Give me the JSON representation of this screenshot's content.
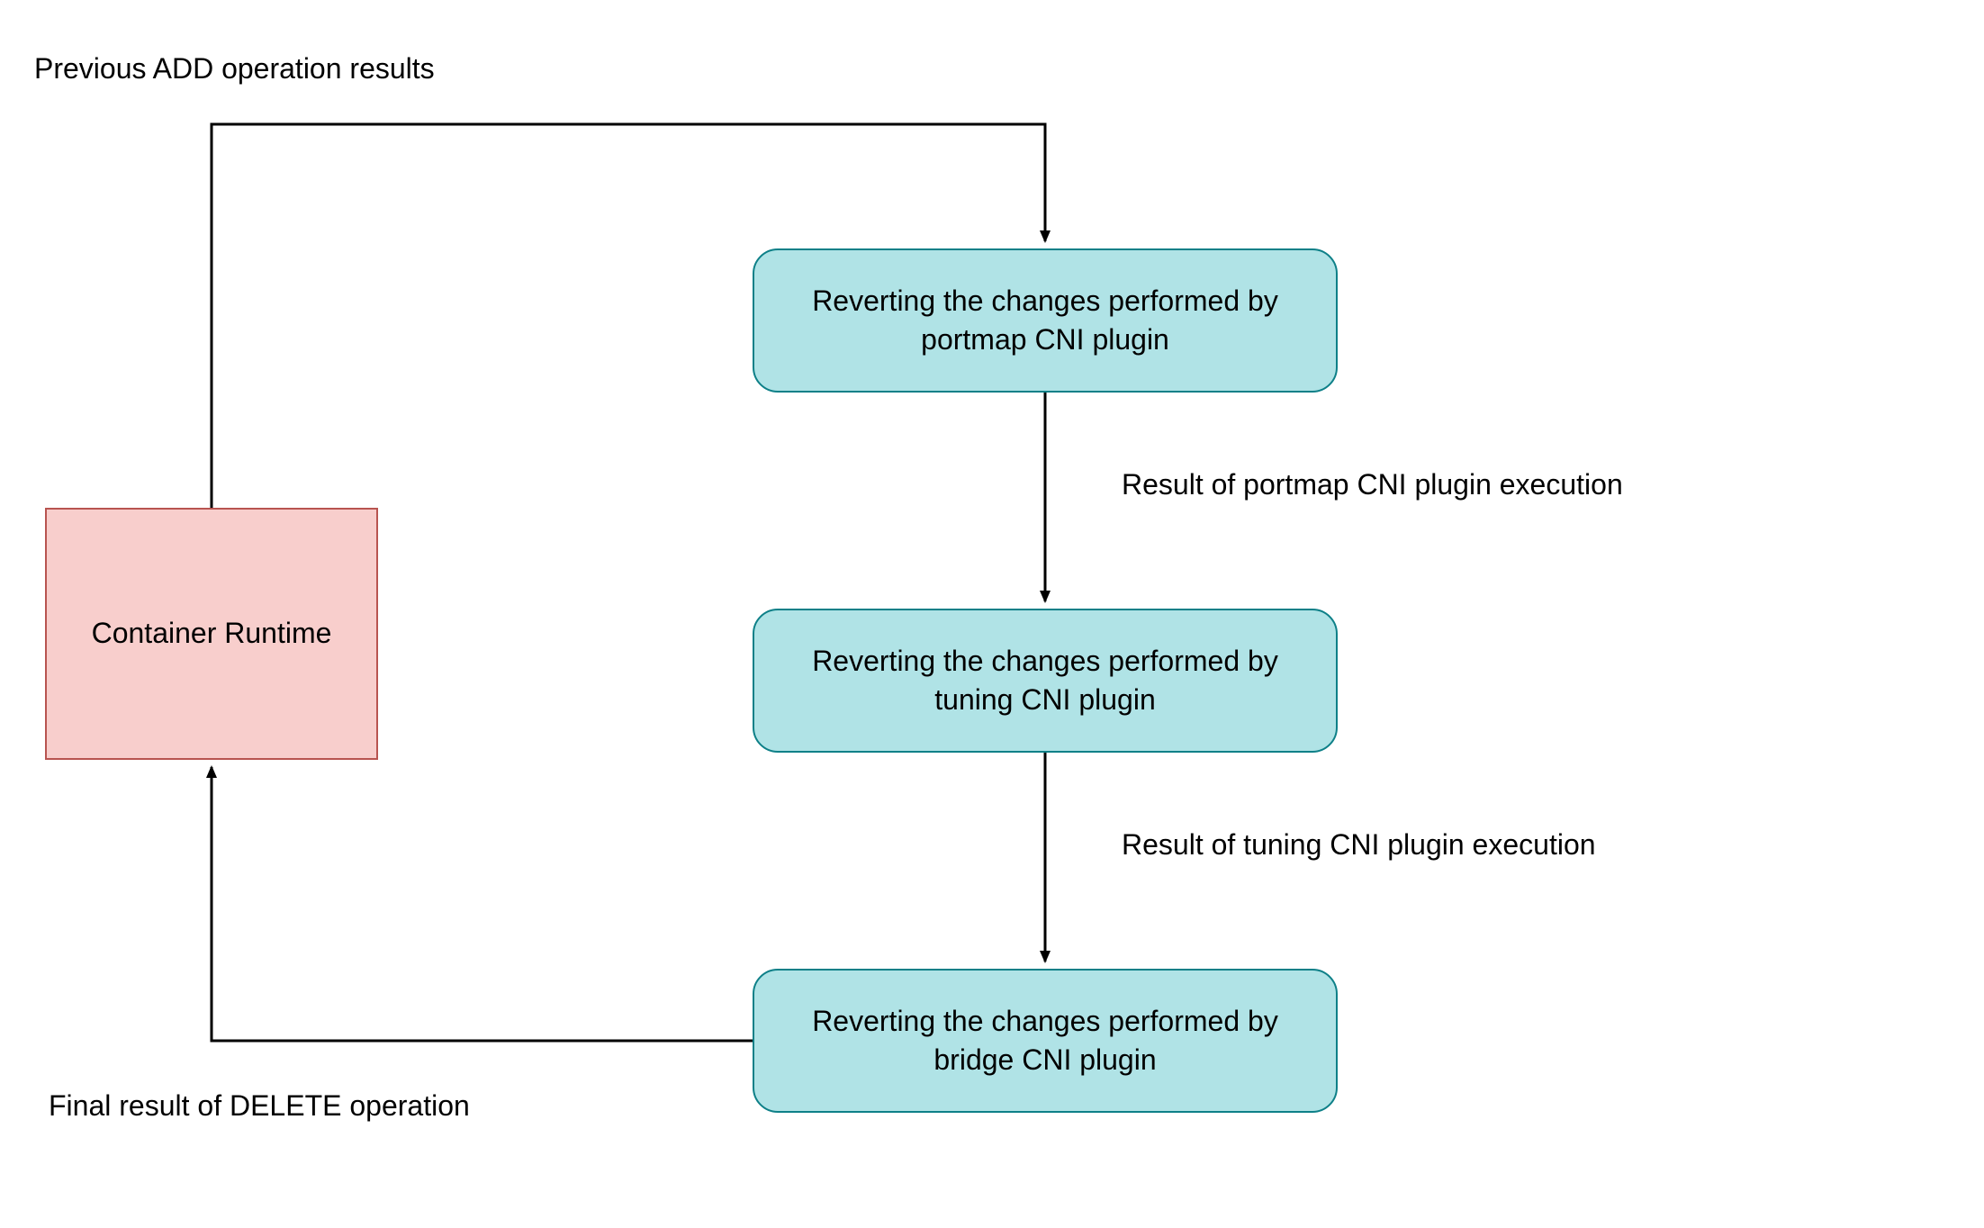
{
  "labels": {
    "top": "Previous ADD operation results",
    "mid1": "Result of portmap CNI plugin execution",
    "mid2": "Result of tuning CNI plugin execution",
    "bottom": "Final result of DELETE operation"
  },
  "nodes": {
    "runtime": "Container Runtime",
    "portmap_line1": "Reverting the changes performed by",
    "portmap_line2": "portmap CNI plugin",
    "tuning_line1": "Reverting the changes performed by",
    "tuning_line2": "tuning CNI plugin",
    "bridge_line1": "Reverting the changes performed by",
    "bridge_line2": "bridge CNI plugin"
  },
  "colors": {
    "runtime_fill": "#f8cecc",
    "runtime_stroke": "#b85450",
    "plugin_fill": "#b0e3e6",
    "plugin_stroke": "#0e8088",
    "line": "#000000"
  }
}
